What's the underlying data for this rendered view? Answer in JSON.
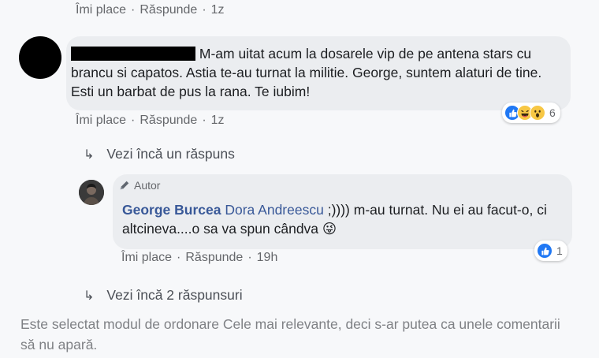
{
  "top_actions": {
    "like": "Îmi place",
    "reply": "Răspunde",
    "time": "1z"
  },
  "comment1": {
    "text": "M-am uitat acum la dosarele vip de pe antena stars cu brancu si capatos. Astia te-au turnat la militie. George, suntem alaturi de tine. Esti un barbat de pus la rana. Te iubim!",
    "reactions": {
      "icons": [
        "like-icon",
        "haha-icon",
        "wow-icon"
      ],
      "count": "6"
    },
    "actions": {
      "like": "Îmi place",
      "reply": "Răspunde",
      "time": "1z"
    }
  },
  "more_reply": {
    "label": "Vezi încă un răspuns"
  },
  "reply1": {
    "badge": "Autor",
    "author": "George Burcea",
    "mention": "Dora Andreescu",
    "text": " ;)))) m-au turnat. Nu ei au facut-o, ci altcineva....o sa va spun cândva",
    "emoji": "😜",
    "reactions": {
      "icons": [
        "like-icon"
      ],
      "count": "1"
    },
    "actions": {
      "like": "Îmi place",
      "reply": "Răspunde",
      "time": "19h"
    }
  },
  "more_replies2": {
    "label": "Vezi încă 2 răspunsuri"
  },
  "footer": {
    "text": "Este selectat modul de ordonare Cele mai relevante, deci s-ar putea ca unele comentarii să nu apară."
  },
  "colors": {
    "like_blue": "#2078f4",
    "link_blue": "#385898",
    "bubble": "#ebedf0"
  }
}
